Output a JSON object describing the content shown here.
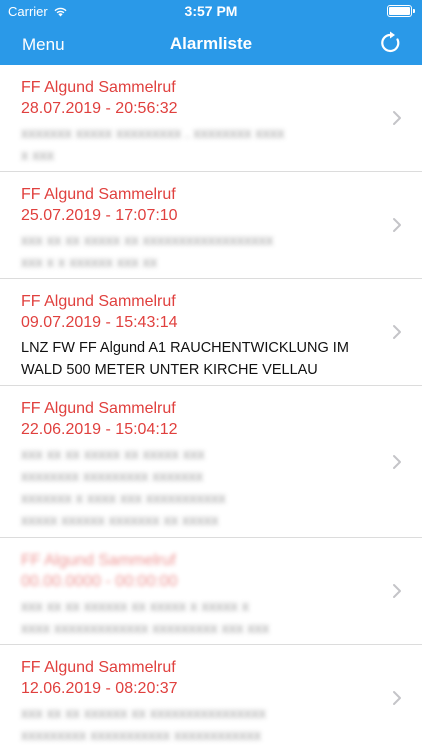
{
  "status": {
    "carrier": "Carrier",
    "time": "3:57 PM"
  },
  "nav": {
    "menu_label": "Menu",
    "title": "Alarmliste",
    "refresh_icon": "refresh-icon"
  },
  "colors": {
    "nav_bg": "#2a99e8",
    "alarm_title": "#e0403e"
  },
  "alarms": [
    {
      "title": "FF Algund  Sammelruf",
      "datetime": "28.07.2019 - 20:56:32",
      "message": "",
      "blurred": true
    },
    {
      "title": "FF Algund  Sammelruf",
      "datetime": "25.07.2019 - 17:07:10",
      "message": "",
      "blurred": true
    },
    {
      "title": "FF Algund  Sammelruf",
      "datetime": "09.07.2019 - 15:43:14",
      "message": "LNZ FW FF Algund A1 RAUCHENTWICKLUNG IM WALD 500 METER UNTER KIRCHE VELLAU",
      "blurred": false
    },
    {
      "title": "FF Algund  Sammelruf",
      "datetime": "22.06.2019 - 15:04:12",
      "message": "",
      "blurred": true
    },
    {
      "title": "",
      "datetime": "",
      "message": "",
      "blurred": true
    },
    {
      "title": "FF Algund  Sammelruf",
      "datetime": "12.06.2019 - 08:20:37",
      "message": "",
      "blurred": true
    }
  ]
}
